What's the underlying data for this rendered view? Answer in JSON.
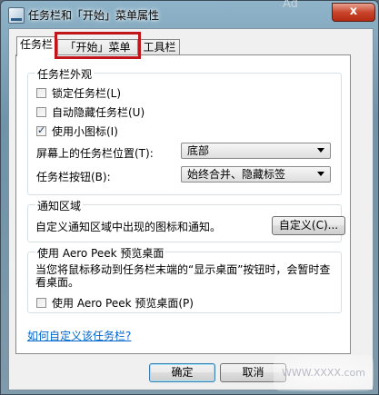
{
  "window": {
    "title": "任务栏和「开始」菜单属性",
    "ghost_text": "Ad",
    "close_glyph": "x"
  },
  "tabs": [
    {
      "label": "任务栏",
      "active": true
    },
    {
      "label": "「开始」菜单",
      "active": false,
      "highlighted": true
    },
    {
      "label": "工具栏",
      "active": false
    }
  ],
  "appearance": {
    "legend": "任务栏外观",
    "lock": {
      "label": "锁定任务栏(L)",
      "checked": false
    },
    "autohide": {
      "label": "自动隐藏任务栏(U)",
      "checked": false
    },
    "small_icons": {
      "label": "使用小图标(I)",
      "checked": true
    },
    "location_label": "屏幕上的任务栏位置(T):",
    "location_value": "底部",
    "buttons_label": "任务栏按钮(B):",
    "buttons_value": "始终合并、隐藏标签"
  },
  "notification": {
    "legend": "通知区域",
    "text": "自定义通知区域中出现的图标和通知。",
    "customize_button": "自定义(C)..."
  },
  "aero_peek": {
    "legend": "使用 Aero Peek 预览桌面",
    "description": "当您将鼠标移动到任务栏末端的“显示桌面”按钮时，会暂时查看桌面。",
    "checkbox": {
      "label": "使用 Aero Peek 预览桌面(P)",
      "checked": false
    }
  },
  "help_link": "如何自定义该任务栏?",
  "footer": {
    "ok": "确定",
    "cancel": "取消"
  },
  "watermark": "WWW.XXXX.com"
}
